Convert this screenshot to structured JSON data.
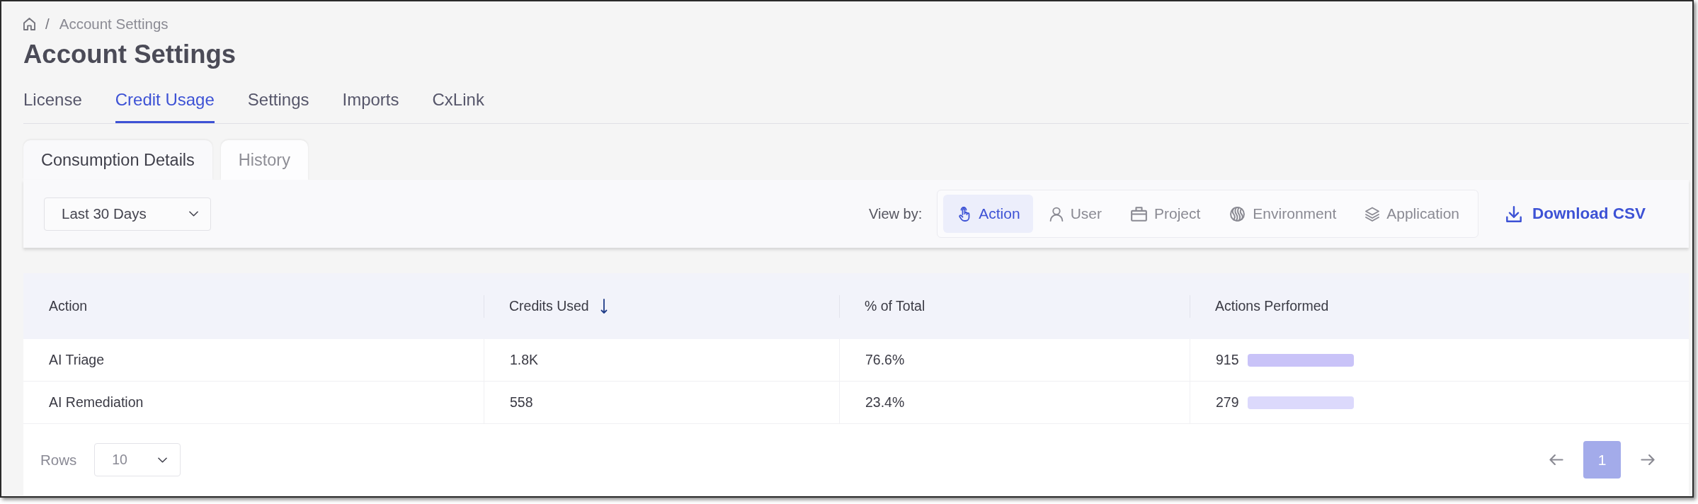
{
  "breadcrumb": {
    "separator": "/",
    "current": "Account Settings"
  },
  "title": "Account Settings",
  "tabs": [
    {
      "label": "License",
      "selected": false
    },
    {
      "label": "Credit Usage",
      "selected": true
    },
    {
      "label": "Settings",
      "selected": false
    },
    {
      "label": "Imports",
      "selected": false
    },
    {
      "label": "CxLink",
      "selected": false
    }
  ],
  "subtabs": [
    {
      "label": "Consumption Details",
      "selected": true
    },
    {
      "label": "History",
      "selected": false
    }
  ],
  "toolbar": {
    "period": "Last 30 Days",
    "view_by_label": "View by:",
    "view_options": [
      {
        "label": "Action",
        "selected": true
      },
      {
        "label": "User",
        "selected": false
      },
      {
        "label": "Project",
        "selected": false
      },
      {
        "label": "Environment",
        "selected": false
      },
      {
        "label": "Application",
        "selected": false
      }
    ],
    "download": "Download CSV"
  },
  "table": {
    "columns": [
      {
        "label": "Action",
        "sort_descending": false
      },
      {
        "label": "Credits Used",
        "sort_descending": true
      },
      {
        "label": "% of Total",
        "sort_descending": false
      },
      {
        "label": "Actions Performed",
        "sort_descending": false
      }
    ],
    "rows": [
      {
        "action": "AI Triage",
        "credits_used": "1.8K",
        "percent_of_total": "76.6%",
        "actions_performed": "915",
        "color": "#c9c3f8"
      },
      {
        "action": "AI Remediation",
        "credits_used": "558",
        "percent_of_total": "23.4%",
        "actions_performed": "279",
        "color": "#dcd9fc"
      }
    ]
  },
  "pagination": {
    "rows_label": "Rows",
    "page_size": "10",
    "pages": [
      {
        "label": "1",
        "selected": true
      }
    ]
  }
}
